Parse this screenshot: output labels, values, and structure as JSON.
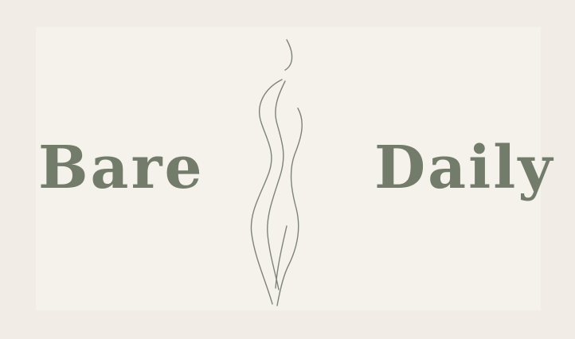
{
  "logo": {
    "word_left": "Bare",
    "word_right": "Daily",
    "figure_icon": "female-silhouette-line-art",
    "text_color": "#737c6b",
    "line_color": "#7d8377",
    "background_color": "#f1ede6"
  }
}
